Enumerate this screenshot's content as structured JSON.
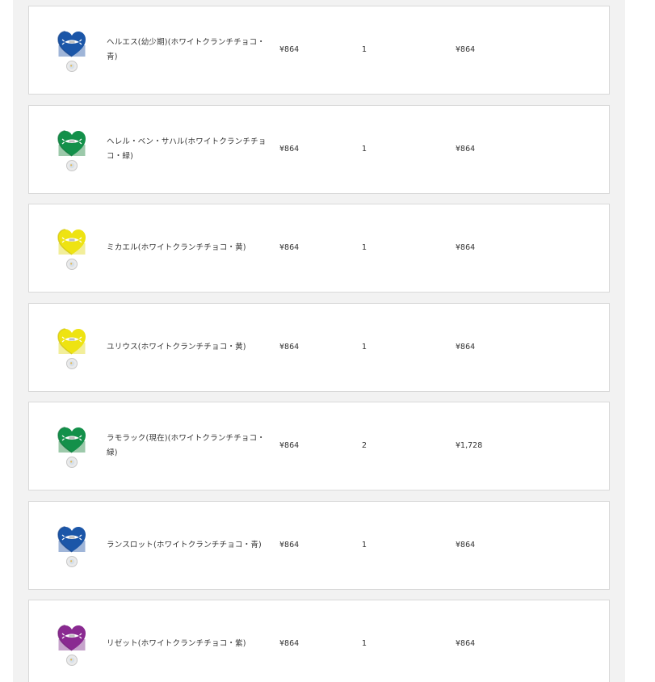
{
  "cart": {
    "items": [
      {
        "name": "ヘルエス(幼少期)(ホワイトクランチチョコ・青)",
        "price": "¥864",
        "quantity": "1",
        "subtotal": "¥864",
        "image": {
          "icon": "heart-chocolate-icon",
          "color": "#1b56a8",
          "shade": "#123f86",
          "band": "#9fb5d8"
        }
      },
      {
        "name": "ヘレル・ベン・サハル(ホワイトクランチチョコ・緑)",
        "price": "¥864",
        "quantity": "1",
        "subtotal": "¥864",
        "image": {
          "icon": "heart-chocolate-icon",
          "color": "#13904a",
          "shade": "#0b6f36",
          "band": "#9cc9aa"
        }
      },
      {
        "name": "ミカエル(ホワイトクランチチョコ・黄)",
        "price": "¥864",
        "quantity": "1",
        "subtotal": "¥864",
        "image": {
          "icon": "heart-chocolate-icon",
          "color": "#eee312",
          "shade": "#c9bd08",
          "band": "#f2ee9a"
        }
      },
      {
        "name": "ユリウス(ホワイトクランチチョコ・黄)",
        "price": "¥864",
        "quantity": "1",
        "subtotal": "¥864",
        "image": {
          "icon": "heart-chocolate-icon",
          "color": "#eee312",
          "shade": "#c9bd08",
          "band": "#f2ee9a"
        }
      },
      {
        "name": "ラモラック(現在)(ホワイトクランチチョコ・緑)",
        "price": "¥864",
        "quantity": "2",
        "subtotal": "¥1,728",
        "image": {
          "icon": "heart-chocolate-icon",
          "color": "#13904a",
          "shade": "#0b6f36",
          "band": "#9cc9aa"
        }
      },
      {
        "name": "ランスロット(ホワイトクランチチョコ・青)",
        "price": "¥864",
        "quantity": "1",
        "subtotal": "¥864",
        "image": {
          "icon": "heart-chocolate-icon",
          "color": "#1b56a8",
          "shade": "#123f86",
          "band": "#9fb5d8"
        }
      },
      {
        "name": "リゼット(ホワイトクランチチョコ・紫)",
        "price": "¥864",
        "quantity": "1",
        "subtotal": "¥864",
        "image": {
          "icon": "heart-chocolate-icon",
          "color": "#8a2a91",
          "shade": "#6a1a72",
          "band": "#c7a4cc"
        }
      }
    ]
  }
}
